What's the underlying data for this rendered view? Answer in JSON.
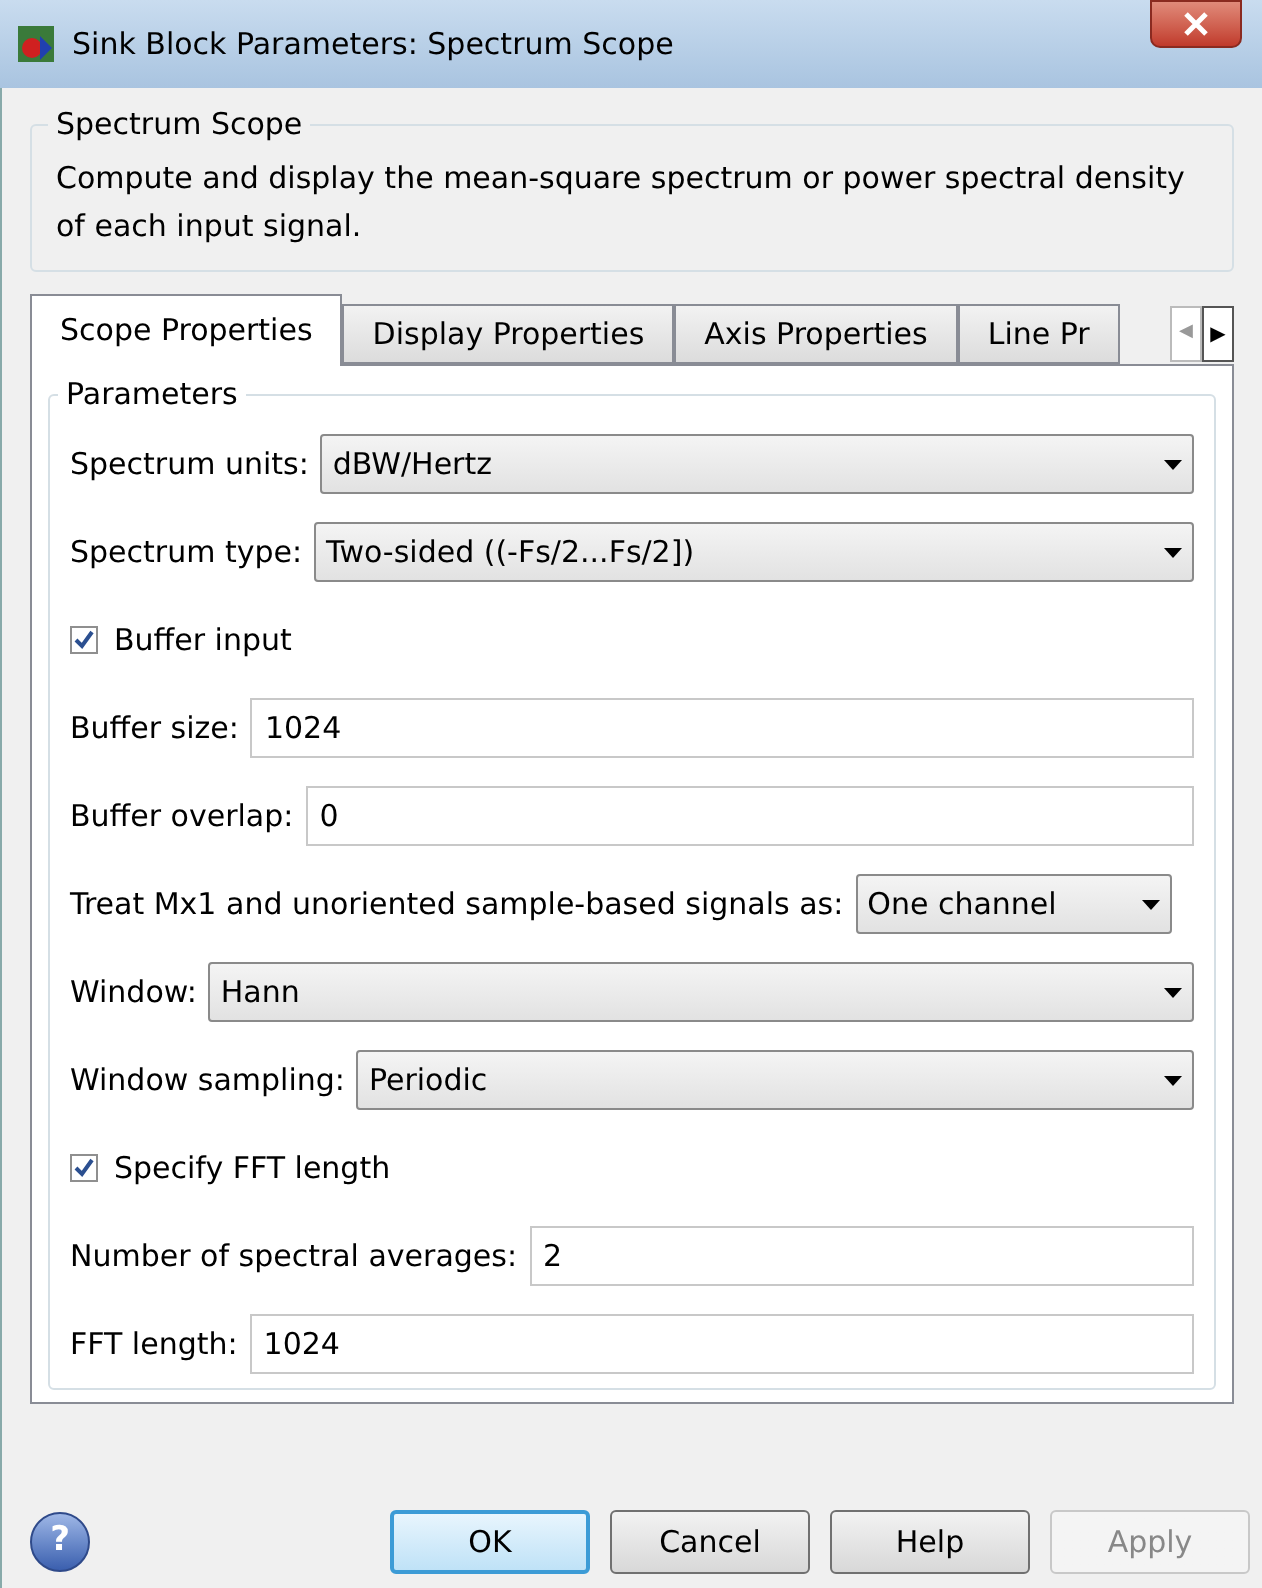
{
  "window": {
    "title": "Sink Block Parameters: Spectrum Scope"
  },
  "description": {
    "title": "Spectrum Scope",
    "text": "Compute and display the mean-square spectrum or power spectral density of each input signal."
  },
  "tabs": [
    {
      "label": "Scope Properties",
      "selected": true
    },
    {
      "label": "Display Properties",
      "selected": false
    },
    {
      "label": "Axis Properties",
      "selected": false
    },
    {
      "label": "Line Pr",
      "selected": false
    }
  ],
  "tab_scroll": {
    "left": "◀",
    "right": "▶"
  },
  "parameters": {
    "title": "Parameters",
    "fields": [
      {
        "kind": "dropdown",
        "label": "Spectrum units:",
        "value": "dBW/Hertz"
      },
      {
        "kind": "dropdown",
        "label": "Spectrum type:",
        "value": "Two-sided ((-Fs/2...Fs/2])"
      },
      {
        "kind": "checkbox",
        "label": "Buffer input",
        "checked": true
      },
      {
        "kind": "text",
        "label": "Buffer size:",
        "value": "1024"
      },
      {
        "kind": "text",
        "label": "Buffer overlap:",
        "value": "0"
      },
      {
        "kind": "dropdown_short",
        "label": "Treat Mx1 and unoriented sample-based signals as:",
        "value": "One channel"
      },
      {
        "kind": "dropdown",
        "label": "Window:",
        "value": "Hann"
      },
      {
        "kind": "dropdown",
        "label": "Window sampling:",
        "value": "Periodic"
      },
      {
        "kind": "checkbox",
        "label": "Specify FFT length",
        "checked": true
      },
      {
        "kind": "text",
        "label": "Number of spectral averages:",
        "value": "2"
      },
      {
        "kind": "text",
        "label": "FFT length:",
        "value": "1024"
      }
    ]
  },
  "help_button": {
    "label": "?"
  },
  "buttons": [
    {
      "label": "OK",
      "kind": "default",
      "disabled": false
    },
    {
      "label": "Cancel",
      "kind": "normal",
      "disabled": false
    },
    {
      "label": "Help",
      "kind": "normal",
      "disabled": false
    },
    {
      "label": "Apply",
      "kind": "normal",
      "disabled": true
    }
  ]
}
